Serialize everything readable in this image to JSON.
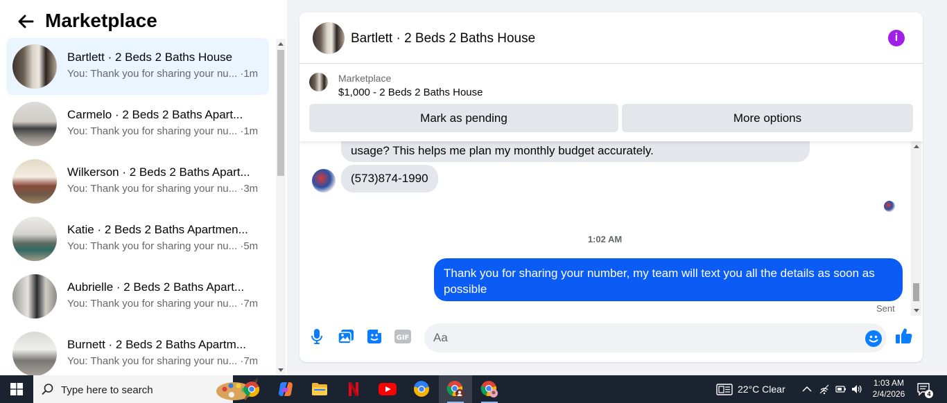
{
  "left_panel": {
    "title": "Marketplace",
    "conversations": [
      {
        "title": "Bartlett · 2 Beds 2 Baths House",
        "preview": "You: Thank you for sharing your nu... ·1m",
        "active": true
      },
      {
        "title": "Carmelo · 2 Beds 2 Baths Apart...",
        "preview": "You: Thank you for sharing your nu... ·1m",
        "active": false
      },
      {
        "title": "Wilkerson · 2 Beds 2 Baths Apart...",
        "preview": "You: Thank you for sharing your nu... ·3m",
        "active": false
      },
      {
        "title": "Katie · 2 Beds 2 Baths Apartmen...",
        "preview": "You: Thank you for sharing your nu... ·5m",
        "active": false
      },
      {
        "title": "Aubrielle · 2 Beds 2 Baths Apart...",
        "preview": "You: Thank you for sharing your nu... ·7m",
        "active": false
      },
      {
        "title": "Burnett · 2 Beds 2 Baths Apartm...",
        "preview": "You: Thank you for sharing your nu... ·7m",
        "active": false
      }
    ]
  },
  "chat": {
    "title": "Bartlett · 2 Beds 2 Baths House",
    "listing": {
      "label": "Marketplace",
      "price_title": "$1,000 - 2 Beds 2 Baths House",
      "pending_button": "Mark as pending",
      "more_button": "More options"
    },
    "messages": {
      "previous_partial": "usage? This helps me plan my monthly budget accurately.",
      "phone": "(573)874-1990",
      "timestamp": "1:02 AM",
      "outgoing": "Thank you for  sharing your number, my team will text you all the details as soon as possible",
      "status": "Sent"
    },
    "composer": {
      "placeholder": "Aa"
    }
  },
  "taskbar": {
    "search_placeholder": "Type here to search",
    "weather": "22°C  Clear",
    "time": "1:03 AM",
    "date": "2/4/2026",
    "notification_count": "4"
  },
  "colors": {
    "outgoing_bubble": "#0a5cf5",
    "active_conversation": "#ebf5ff",
    "info_icon": "#a01ee6",
    "accent_icons": "#0a7cff"
  }
}
